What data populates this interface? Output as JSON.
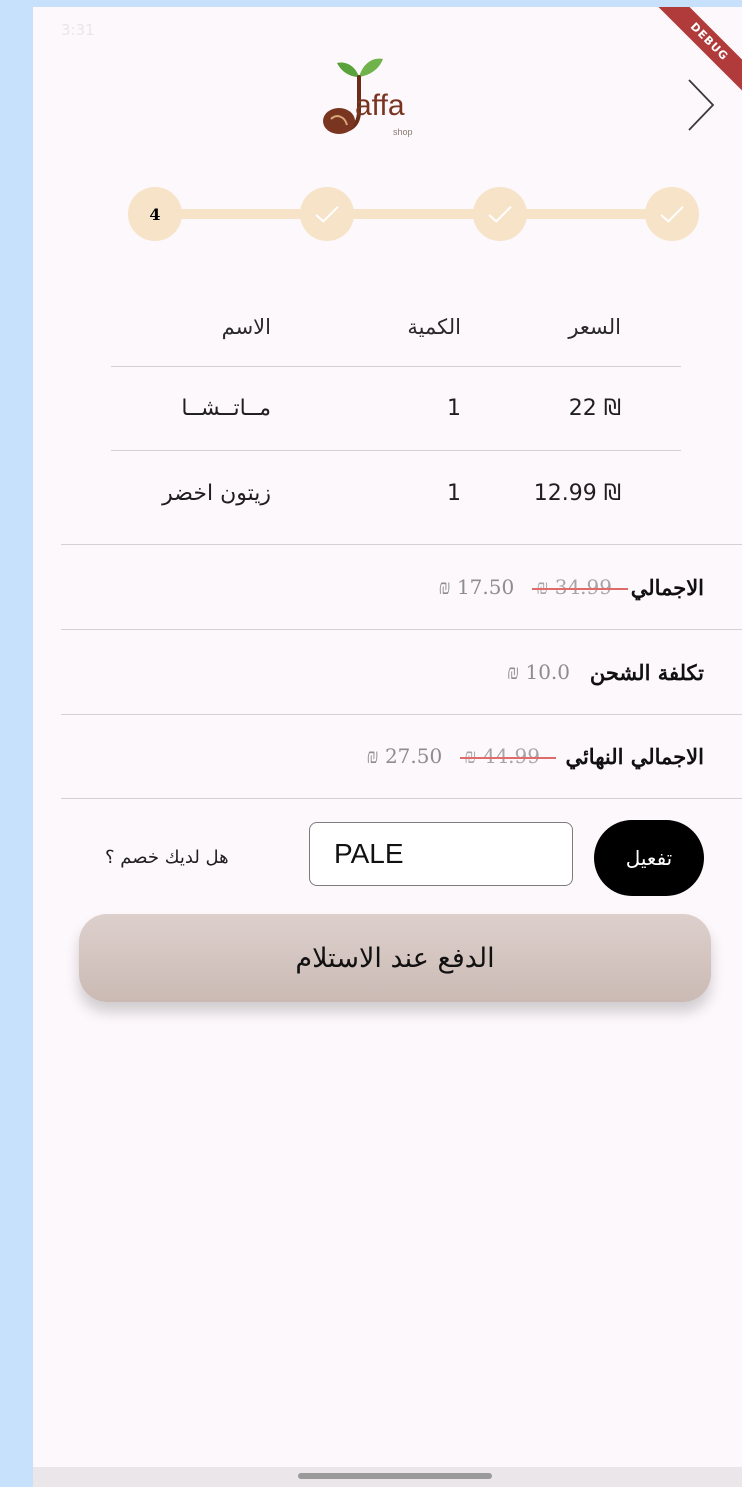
{
  "status": {
    "time": "3:31",
    "system": ""
  },
  "debug_banner": "DEBUG",
  "logo": {
    "word": "affa",
    "sub": "shop"
  },
  "stepper": {
    "current": "4",
    "steps": [
      "4",
      "done",
      "done",
      "done"
    ]
  },
  "table": {
    "headers": {
      "price": "السعر",
      "quantity": "الكمية",
      "name": "الاسم"
    },
    "rows": [
      {
        "name": "مــاتــشــا",
        "quantity": "1",
        "price": "₪ 22"
      },
      {
        "name": "زيتون اخضر",
        "quantity": "1",
        "price": "₪ 12.99"
      }
    ]
  },
  "summary": {
    "subtotal": {
      "label": "الاجمالي",
      "original": "₪ 34.99",
      "discounted": "₪ 17.50"
    },
    "shipping": {
      "label": "تكلفة الشحن",
      "value": "₪ 10.0"
    },
    "total": {
      "label": "الاجمالي النهائي",
      "original": "₪ 44.99",
      "discounted": "₪ 27.50"
    }
  },
  "coupon": {
    "question": "هل لديك خصم ؟",
    "code": "PALE",
    "apply_label": "تفعيل"
  },
  "pay_button": {
    "label": "الدفع عند الاستلام"
  },
  "colors": {
    "accent": "#f6e3c8",
    "strike": "#e06b6b",
    "pay_button": "#d3c4bf",
    "apply_button": "#000000"
  }
}
